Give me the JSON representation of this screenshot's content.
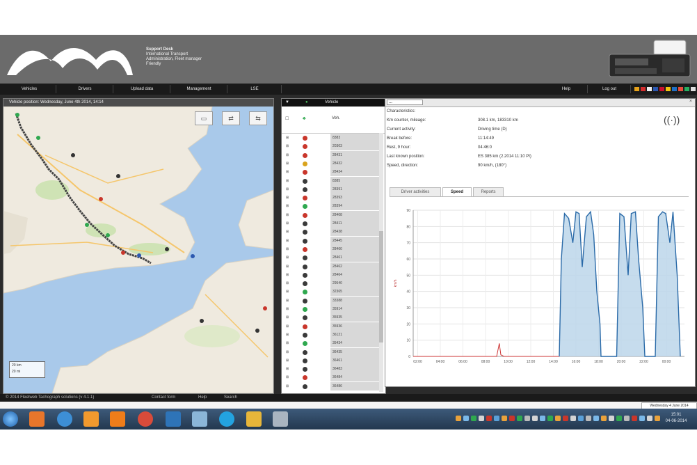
{
  "company": {
    "lines": [
      "Support Desk",
      "International Transport",
      "Administration, Fleet manager",
      "Friendly"
    ]
  },
  "menu": {
    "items": [
      "Vehicles",
      "Drivers",
      "Upload data",
      "Management",
      "LSE"
    ],
    "right_items": [
      "Help",
      "Log out"
    ]
  },
  "map": {
    "title": "Vehicle position: Wednesday, June 4th 2014, 14:14",
    "buttons": [
      "▭",
      "⇄",
      "⇆"
    ],
    "scale_labels": [
      "20 km",
      "20 mi"
    ]
  },
  "vehicle_list": {
    "header": "Vehicle",
    "column_header": "Veh.",
    "rows": [
      {
        "id": "8383",
        "status": "#c9362b"
      },
      {
        "id": "20303",
        "status": "#c9362b"
      },
      {
        "id": "28431",
        "status": "#c9362b"
      },
      {
        "id": "28432",
        "status": "#d9a31c"
      },
      {
        "id": "28434",
        "status": "#c9362b"
      },
      {
        "id": "8385",
        "status": "#3a3a3a"
      },
      {
        "id": "28391",
        "status": "#3a3a3a"
      },
      {
        "id": "28393",
        "status": "#c9362b"
      },
      {
        "id": "28394",
        "status": "#2fa84f"
      },
      {
        "id": "28408",
        "status": "#c9362b"
      },
      {
        "id": "28411",
        "status": "#3a3a3a"
      },
      {
        "id": "28438",
        "status": "#3a3a3a"
      },
      {
        "id": "28445",
        "status": "#3a3a3a"
      },
      {
        "id": "28460",
        "status": "#c9362b"
      },
      {
        "id": "28461",
        "status": "#3a3a3a"
      },
      {
        "id": "28462",
        "status": "#3a3a3a"
      },
      {
        "id": "28464",
        "status": "#3a3a3a"
      },
      {
        "id": "29540",
        "status": "#3a3a3a"
      },
      {
        "id": "32365",
        "status": "#2fa84f"
      },
      {
        "id": "33388",
        "status": "#3a3a3a"
      },
      {
        "id": "35914",
        "status": "#2fa84f"
      },
      {
        "id": "35935",
        "status": "#3a3a3a"
      },
      {
        "id": "35936",
        "status": "#c9362b"
      },
      {
        "id": "36121",
        "status": "#3a3a3a"
      },
      {
        "id": "35434",
        "status": "#2fa84f"
      },
      {
        "id": "36435",
        "status": "#3a3a3a"
      },
      {
        "id": "36461",
        "status": "#3a3a3a"
      },
      {
        "id": "36483",
        "status": "#3a3a3a"
      },
      {
        "id": "36484",
        "status": "#c9362b"
      },
      {
        "id": "36486",
        "status": "#3a3a3a"
      }
    ]
  },
  "details": {
    "select_value": "---",
    "info": [
      {
        "label": "Characteristics:",
        "value": ""
      },
      {
        "label": "Km counter, mileage:",
        "value": "308.1 km, 183310 km"
      },
      {
        "label": "Current activity:",
        "value": "Driving time (D)"
      },
      {
        "label": "Break before:",
        "value": "11:14:49"
      },
      {
        "label": "Rest, 9 hour:",
        "value": "04:46:0"
      },
      {
        "label": "Last known position:",
        "value": "ES 385 km (2.2014 11:10 PI)"
      },
      {
        "label": "Speed, direction:",
        "value": "90 km/h, (180°)"
      }
    ],
    "tabs": [
      "Driver activities",
      "Speed",
      "Reports"
    ],
    "active_tab": 1
  },
  "chart_data": {
    "type": "area",
    "title": "",
    "xlabel": "",
    "ylabel": "km/h",
    "x_ticks": [
      "02:00",
      "04:00",
      "06:00",
      "08:00",
      "10:00",
      "12:00",
      "14:00",
      "16:00",
      "18:00",
      "20:00",
      "22:00",
      "00:00"
    ],
    "y_ticks": [
      0,
      10,
      20,
      30,
      40,
      50,
      60,
      70,
      80,
      90
    ],
    "xlim": [
      0,
      22
    ],
    "ylim": [
      0,
      90
    ],
    "grid": true,
    "series": [
      {
        "color": "#cc3333",
        "x": [
          0,
          8.0,
          8.25,
          8.4,
          8.7,
          14.0
        ],
        "y": [
          0,
          0,
          8,
          1,
          0,
          0
        ]
      },
      {
        "color": "#2a6aa8",
        "x": [
          14.0,
          14.2,
          14.5,
          14.9,
          15.3,
          15.6,
          15.9,
          16.2,
          16.6,
          17.0,
          17.3,
          17.6,
          17.9,
          18.0,
          19.5,
          19.8,
          20.2,
          20.6,
          20.9,
          21.3,
          21.6,
          22.0,
          22.2,
          22.5,
          23.2,
          23.5,
          23.9,
          24.2,
          24.6,
          24.9,
          25.3,
          25.6
        ],
        "y": [
          0,
          60,
          88,
          85,
          70,
          89,
          88,
          55,
          86,
          89,
          75,
          40,
          20,
          0,
          0,
          88,
          86,
          50,
          88,
          89,
          60,
          30,
          0,
          0,
          0,
          86,
          89,
          88,
          70,
          89,
          50,
          0
        ]
      }
    ]
  },
  "footer": {
    "copyright": "© 2014 Fleetweb Tachograph solutions (v 4.1.1)",
    "links": [
      "Contact form",
      "Help",
      "Search"
    ],
    "date": "Wednesday 4 June 2014"
  },
  "taskbar": {
    "time": "15:01",
    "date": "04-06-2014",
    "icons": [
      "start",
      "firefox",
      "ie",
      "media",
      "vlc",
      "chrome",
      "globe",
      "network",
      "skype",
      "paint",
      "tool"
    ]
  },
  "colors": {
    "header_bg": "#6b6b6b",
    "menu_bg": "#1a1a1a",
    "map_water": "#a9c9ea",
    "map_land": "#efeadf",
    "route": "#444444",
    "chart_fill": "#bcd6ea",
    "chart_line": "#2a6aa8"
  }
}
